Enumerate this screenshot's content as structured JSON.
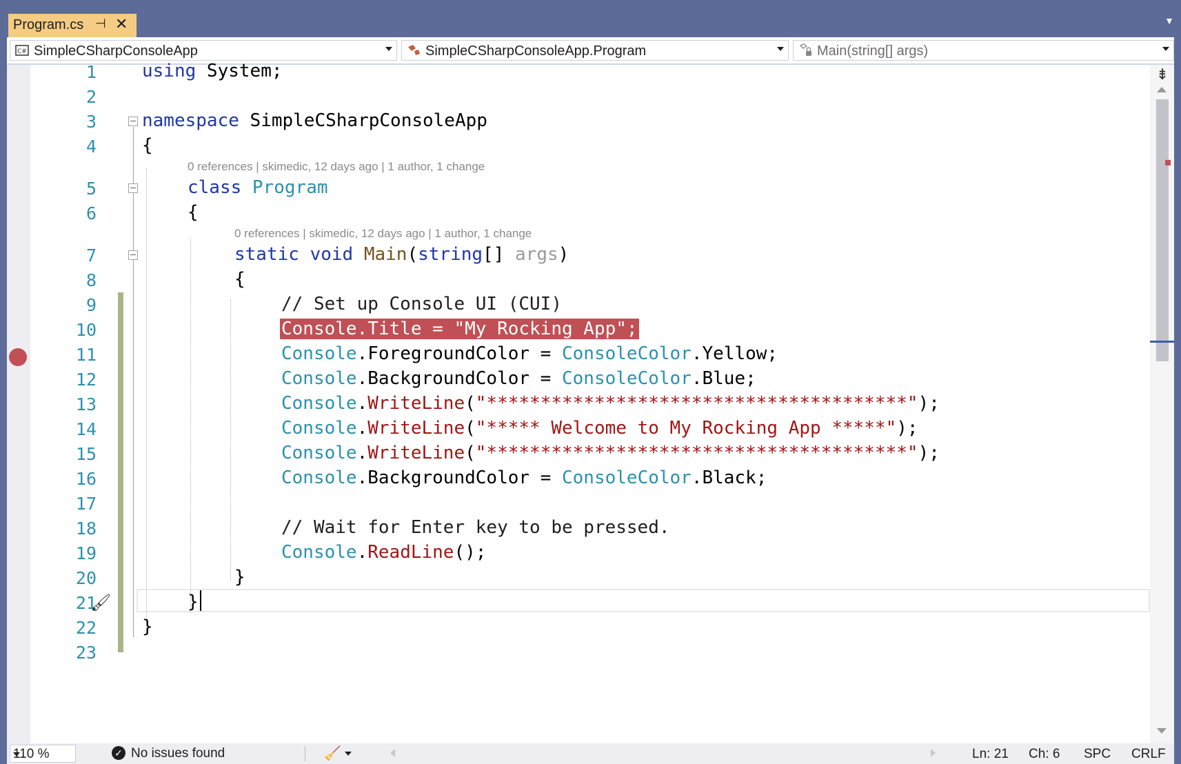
{
  "tab": {
    "title": "Program.cs",
    "pin_icon": "pin-icon",
    "close_icon": "close-icon"
  },
  "navbar": {
    "project": "SimpleCSharpConsoleApp",
    "class": "SimpleCSharpConsoleApp.Program",
    "member": "Main(string[] args)"
  },
  "line_numbers": [
    "1",
    "2",
    "3",
    "4",
    "5",
    "6",
    "7",
    "8",
    "9",
    "10",
    "11",
    "12",
    "13",
    "14",
    "15",
    "16",
    "17",
    "18",
    "19",
    "20",
    "21",
    "22",
    "23"
  ],
  "codelens": {
    "class_lens": "0 references | skimedic, 12 days ago | 1 author, 1 change",
    "method_lens": "0 references | skimedic, 12 days ago | 1 author, 1 change"
  },
  "code": {
    "l1_kw": "using",
    "l1_rest": " System;",
    "l3_kw": "namespace",
    "l3_rest": " SimpleCSharpConsoleApp",
    "l4": "{",
    "l5_kw": "class",
    "l5_type": " Program",
    "l6": "{",
    "l7_kw": "static void",
    "l7_fn": " Main",
    "l7_p1": "(",
    "l7_kw2": "string",
    "l7_p2": "[] ",
    "l7_arg": "args",
    "l7_p3": ")",
    "l8": "{",
    "l9": "// Set up Console UI (CUI)",
    "l10": "Console.Title = \"My Rocking App\";",
    "l11_t": "Console",
    "l11_a": ".ForegroundColor = ",
    "l11_t2": "ConsoleColor",
    "l11_b": ".Yellow;",
    "l12_t": "Console",
    "l12_a": ".BackgroundColor = ",
    "l12_t2": "ConsoleColor",
    "l12_b": ".Blue;",
    "l13_t": "Console",
    "l13_a": ".",
    "l13_fn": "WriteLine",
    "l13_p": "(",
    "l13_s": "\"***************************************\"",
    "l13_e": ");",
    "l14_t": "Console",
    "l14_a": ".",
    "l14_fn": "WriteLine",
    "l14_p": "(",
    "l14_s": "\"***** Welcome to My Rocking App *****\"",
    "l14_e": ");",
    "l15_t": "Console",
    "l15_a": ".",
    "l15_fn": "WriteLine",
    "l15_p": "(",
    "l15_s": "\"***************************************\"",
    "l15_e": ");",
    "l16_t": "Console",
    "l16_a": ".BackgroundColor = ",
    "l16_t2": "ConsoleColor",
    "l16_b": ".Black;",
    "l18": "// Wait for Enter key to be pressed.",
    "l19_t": "Console",
    "l19_a": ".",
    "l19_fn": "ReadLine",
    "l19_e": "();",
    "l20": "}",
    "l21": "}",
    "l22": "}"
  },
  "statusbar": {
    "zoom": "110 %",
    "issues": "No issues found",
    "ln": "Ln: 21",
    "ch": "Ch: 6",
    "spc": "SPC",
    "crlf": "CRLF"
  },
  "colors": {
    "breakpoint": "#c05055",
    "tab_active": "#f5cc84",
    "frame": "#5d6b99",
    "keyword": "#1f37a8",
    "type": "#2b91af",
    "string": "#a31515"
  }
}
